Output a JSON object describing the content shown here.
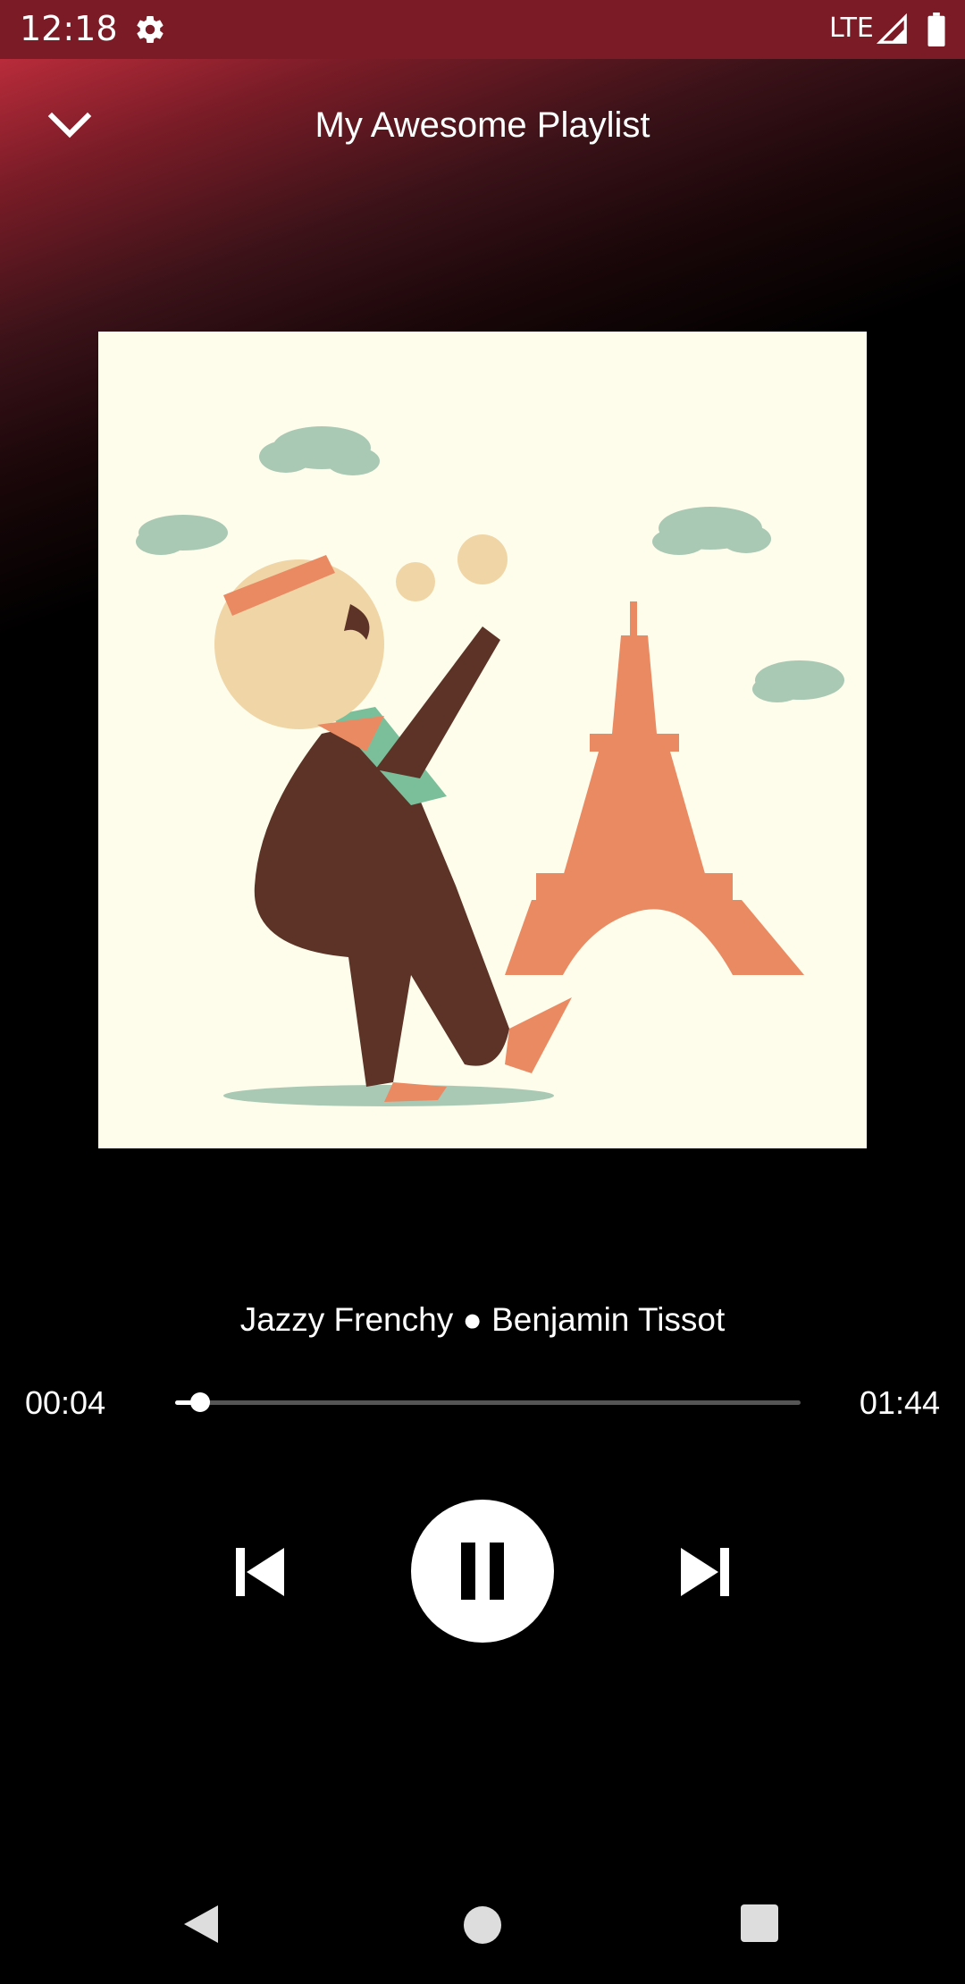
{
  "status_bar": {
    "time": "12:18",
    "network": "LTE",
    "icons": [
      "gear-icon",
      "signal-icon",
      "battery-icon"
    ]
  },
  "header": {
    "title": "My Awesome Playlist",
    "collapse_icon": "chevron-down-icon"
  },
  "artwork": {
    "icon": "album-art-illustration"
  },
  "track": {
    "title_line": "Jazzy Frenchy ● Benjamin Tissot"
  },
  "progress": {
    "current": "00:04",
    "total": "01:44",
    "fraction": 0.04
  },
  "controls": {
    "previous_icon": "skip-previous-icon",
    "pause_icon": "pause-icon",
    "next_icon": "skip-next-icon"
  },
  "nav_bar": {
    "icons": [
      "back-icon",
      "home-icon",
      "recents-icon"
    ]
  },
  "colors": {
    "accent_gradient_top": "#d63344",
    "status_bar": "#7a1b26",
    "background": "#000000",
    "artwork_bg": "#fefdec"
  }
}
